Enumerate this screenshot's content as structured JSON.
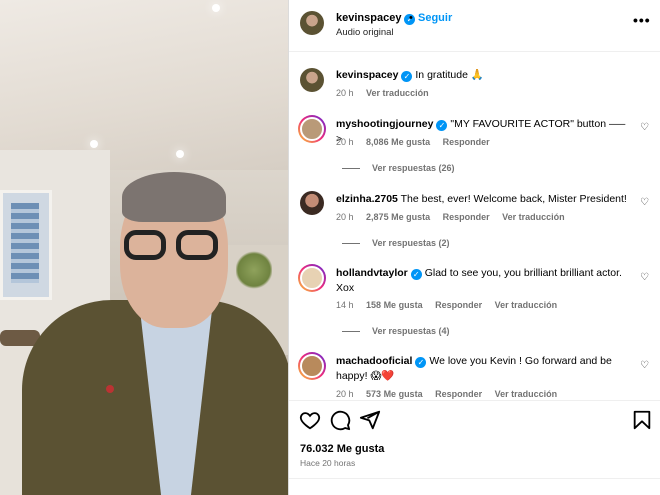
{
  "post": {
    "author": "kevinspacey",
    "follow_label": "Seguir",
    "separator": "•",
    "audio": "Audio original",
    "caption": "In gratitude 🙏",
    "caption_time": "20 h",
    "caption_translate": "Ver traducción"
  },
  "comments": [
    {
      "username": "myshootingjourney",
      "text": "\"MY FAVOURITE ACTOR\" button —–>",
      "time": "20 h",
      "likes": "8,086 Me gusta",
      "reply": "Responder",
      "translate": "",
      "view_replies": "Ver respuestas (26)"
    },
    {
      "username": "elzinha.2705",
      "text": "The best, ever! Welcome back, Mister President!",
      "time": "20 h",
      "likes": "2,875 Me gusta",
      "reply": "Responder",
      "translate": "Ver traducción",
      "view_replies": "Ver respuestas (2)"
    },
    {
      "username": "hollandvtaylor",
      "text": "Glad to see you, you brilliant brilliant actor. Xox",
      "time": "14 h",
      "likes": "158 Me gusta",
      "reply": "Responder",
      "translate": "Ver traducción",
      "view_replies": "Ver respuestas (4)"
    },
    {
      "username": "machadooficial",
      "text": "We love you Kevin ! Go forward and be happy! 😱❤️",
      "time": "20 h",
      "likes": "573 Me gusta",
      "reply": "Responder",
      "translate": "Ver traducción",
      "view_replies": ""
    }
  ],
  "footer": {
    "likes": "76.032 Me gusta",
    "time_ago": "Hace 20 horas"
  },
  "icons": {
    "like": "heart-icon",
    "comment": "comment-icon",
    "share": "share-icon",
    "save": "bookmark-icon",
    "more": "more-options-icon"
  },
  "colors": {
    "accent": "#0095f6",
    "secondary_text": "#737373"
  }
}
